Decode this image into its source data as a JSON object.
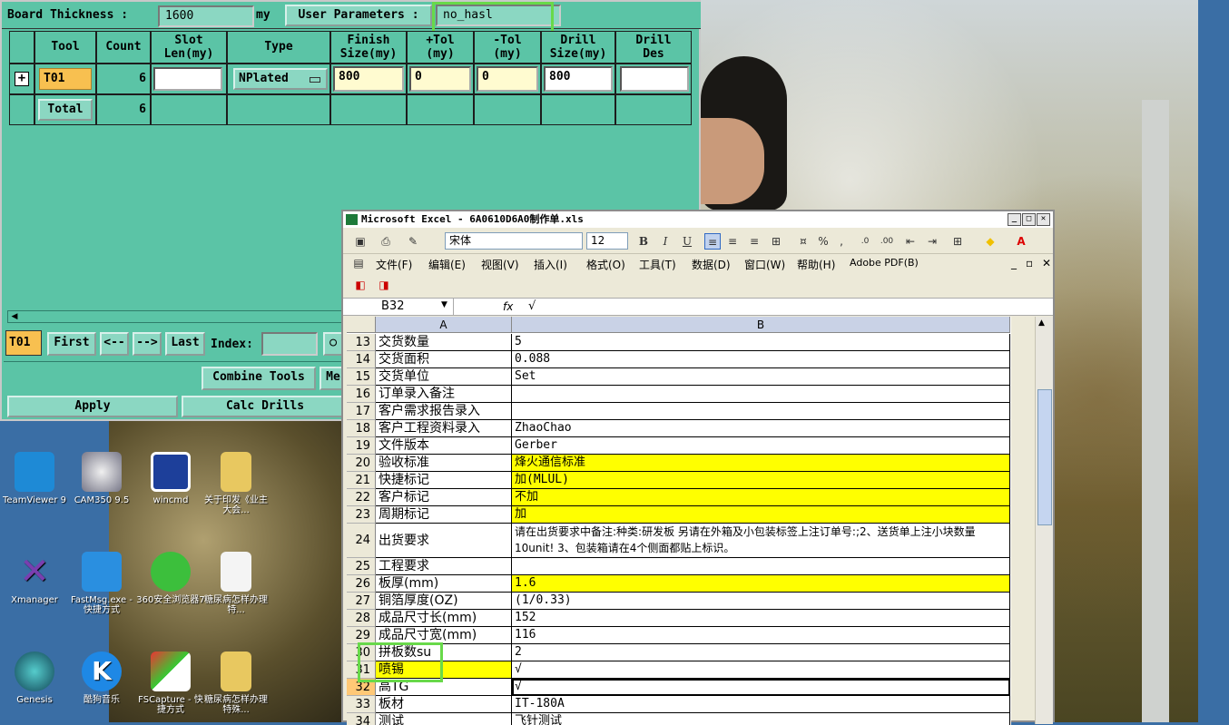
{
  "cam": {
    "board_thickness_label": "Board Thickness :",
    "board_thickness_value": "1600",
    "board_thickness_unit": "my",
    "user_params_label": "User Parameters :",
    "user_params_value": "no_hasl",
    "headers": [
      "Tool",
      "Count",
      "Slot Len(my)",
      "Type",
      "Finish Size(my)",
      "+Tol (my)",
      "-Tol (my)",
      "Drill Size(my)",
      "Drill Des"
    ],
    "row1": {
      "tool": "T01",
      "count": "6",
      "slot_len": "",
      "type": "NPlated",
      "finish": "800",
      "plus_tol": "0",
      "minus_tol": "0",
      "drill_size": "800",
      "drill_des": ""
    },
    "total": {
      "label": "Total",
      "count": "6"
    },
    "nav": {
      "current": "T01",
      "first": "First",
      "prev": "<--",
      "next": "-->",
      "last": "Last",
      "index_label": "Index:",
      "index_value": ""
    },
    "buttons": {
      "combine": "Combine Tools",
      "me": "Me",
      "apply": "Apply",
      "calc": "Calc Drills"
    }
  },
  "excel": {
    "title": "Microsoft Excel - 6A0610D6A0制作单.xls",
    "font_name": "宋体",
    "font_size": "12",
    "menus": [
      "文件(F)",
      "编辑(E)",
      "视图(V)",
      "插入(I)",
      "格式(O)",
      "工具(T)",
      "数据(D)",
      "窗口(W)",
      "帮助(H)",
      "Adobe PDF(B)"
    ],
    "name_box": "B32",
    "formula": "√",
    "col_a": "A",
    "col_b": "B",
    "rows": [
      {
        "n": "13",
        "a": "交货数量",
        "b": "5"
      },
      {
        "n": "14",
        "a": "交货面积",
        "b": "0.088"
      },
      {
        "n": "15",
        "a": "交货单位",
        "b": "Set"
      },
      {
        "n": "16",
        "a": "订单录入备注",
        "b": ""
      },
      {
        "n": "17",
        "a": "客户需求报告录入",
        "b": ""
      },
      {
        "n": "18",
        "a": "客户工程资料录入",
        "b": "ZhaoChao"
      },
      {
        "n": "19",
        "a": "文件版本",
        "b": "Gerber"
      },
      {
        "n": "20",
        "a": "验收标准",
        "b": "烽火通信标准"
      },
      {
        "n": "21",
        "a": "快捷标记",
        "b": "加(MLUL)"
      },
      {
        "n": "22",
        "a": "客户标记",
        "b": "不加"
      },
      {
        "n": "23",
        "a": "周期标记",
        "b": "加"
      },
      {
        "n": "24",
        "a": "出货要求",
        "b": "请在出货要求中备注:种类:研发板  另请在外箱及小包装标签上注订单号:;2、送货单上注小块数量10unit! 3、包装箱请在4个侧面都贴上标识。"
      },
      {
        "n": "25",
        "a": "工程要求",
        "b": ""
      },
      {
        "n": "26",
        "a": "板厚(mm)",
        "b": "1.6"
      },
      {
        "n": "27",
        "a": "铜箔厚度(OZ)",
        "b": "(1/0.33)"
      },
      {
        "n": "28",
        "a": "成品尺寸长(mm)",
        "b": "152"
      },
      {
        "n": "29",
        "a": "成品尺寸宽(mm)",
        "b": "116"
      },
      {
        "n": "30",
        "a": "拼板数su",
        "b": "2"
      },
      {
        "n": "31",
        "a": "喷锡",
        "b": "√"
      },
      {
        "n": "32",
        "a": "高TG",
        "b": "√"
      },
      {
        "n": "33",
        "a": "板材",
        "b": "IT-180A"
      },
      {
        "n": "34",
        "a": "测试",
        "b": "飞针测试"
      }
    ]
  },
  "desktop": {
    "icons": [
      "TeamViewer 9",
      "CAM350 9.5",
      "wincmd",
      "关于印发《业主大会...",
      "Xmanager",
      "FastMsg.exe - 快捷方式",
      "360安全浏览器7",
      "糖尿病怎样办理特...",
      "Genesis",
      "酷狗音乐",
      "FSCapture - 快捷方式",
      "糖尿病怎样办理特殊..."
    ]
  }
}
